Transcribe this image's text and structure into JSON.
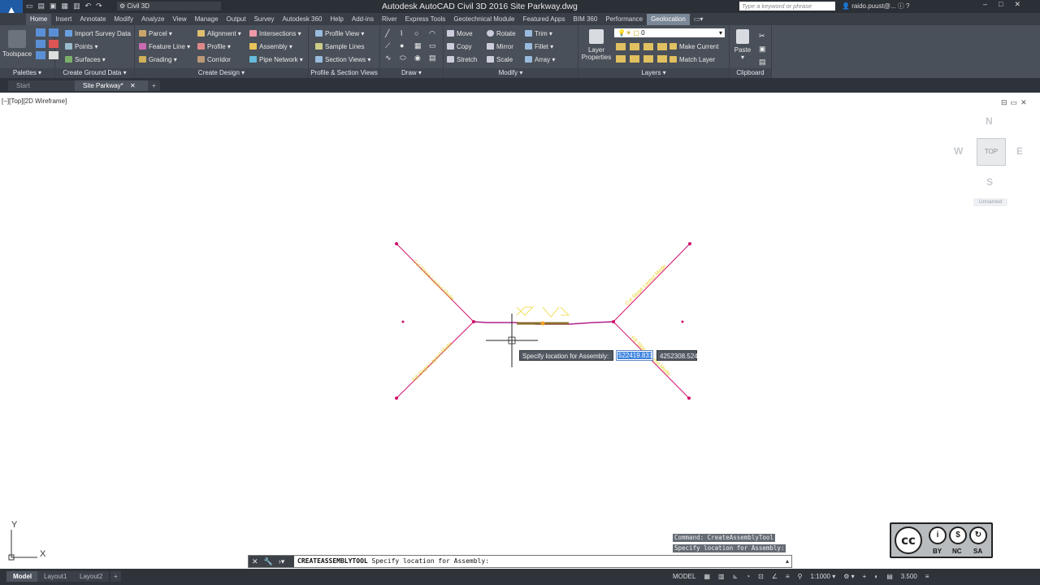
{
  "window": {
    "title": "Autodesk AutoCAD Civil 3D 2016    Site Parkway.dwg",
    "workspace": "Civil 3D",
    "search_placeholder": "Type a keyword or phrase",
    "user": "raido.puust@...",
    "app_button": "C3D"
  },
  "ribbon_tabs": [
    "Home",
    "Insert",
    "Annotate",
    "Modify",
    "Analyze",
    "View",
    "Manage",
    "Output",
    "Survey",
    "Autodesk 360",
    "Help",
    "Add-ins",
    "River",
    "Express Tools",
    "Geotechnical Module",
    "Featured Apps",
    "BIM 360",
    "Performance",
    "Geolocation"
  ],
  "ribbon": {
    "palettes": {
      "title": "Palettes",
      "toolspace": "Toolspace"
    },
    "ground": {
      "title": "Create Ground Data",
      "items": [
        "Import Survey Data",
        "Points",
        "Surfaces"
      ]
    },
    "design": {
      "title": "Create Design",
      "col1": [
        "Parcel",
        "Feature Line",
        "Grading"
      ],
      "col2": [
        "Alignment",
        "Profile",
        "Corridor"
      ],
      "col3": [
        "Intersections",
        "Assembly",
        "Pipe Network"
      ]
    },
    "profile": {
      "title": "Profile & Section Views",
      "items": [
        "Profile View",
        "Sample Lines",
        "Section Views"
      ]
    },
    "draw": {
      "title": "Draw"
    },
    "modify": {
      "title": "Modify",
      "col1": [
        "Move",
        "Copy",
        "Stretch"
      ],
      "col2": [
        "Rotate",
        "Mirror",
        "Scale"
      ],
      "col3": [
        "Trim",
        "Fillet",
        "Array"
      ]
    },
    "layers": {
      "title": "Layers",
      "layer_properties": "Layer Properties",
      "current_layer": "0",
      "make_current": "Make Current",
      "match_layer": "Match Layer"
    },
    "clipboard": {
      "title": "Clipboard",
      "paste": "Paste"
    }
  },
  "file_tabs": [
    "Start",
    "Site Parkway*"
  ],
  "viewport": {
    "label": "[−][Top][2D Wireframe]",
    "viewcube": {
      "face": "TOP",
      "n": "N",
      "s": "S",
      "e": "E",
      "w": "W",
      "ucs": "Unnamed"
    },
    "prompt": "Specify location for Assembly:",
    "x_value": "522419.831",
    "y_value": "4252308.524",
    "labels": {
      "cut_left": "Cut Slope Layout Mode",
      "cut_right": "Cut Slope Layout Mode",
      "fill_left": "Fill Slope Layout Mode",
      "fill_right": "Fill Slope Layout Mode"
    },
    "ucs_x": "X",
    "ucs_y": "Y"
  },
  "command_history": [
    "Command: CreateAssemblyTool",
    "Specify location for Assembly:"
  ],
  "command_line": {
    "command": "CREATEASSEMBLYTOOL",
    "text": " Specify location for Assembly:"
  },
  "layout_tabs": [
    "Model",
    "Layout1",
    "Layout2"
  ],
  "status": {
    "model": "MODEL",
    "scale": "1:1000",
    "lineweight": "3.500"
  },
  "license": {
    "cc": "cc",
    "by": "BY",
    "nc": "NC",
    "sa": "SA"
  }
}
